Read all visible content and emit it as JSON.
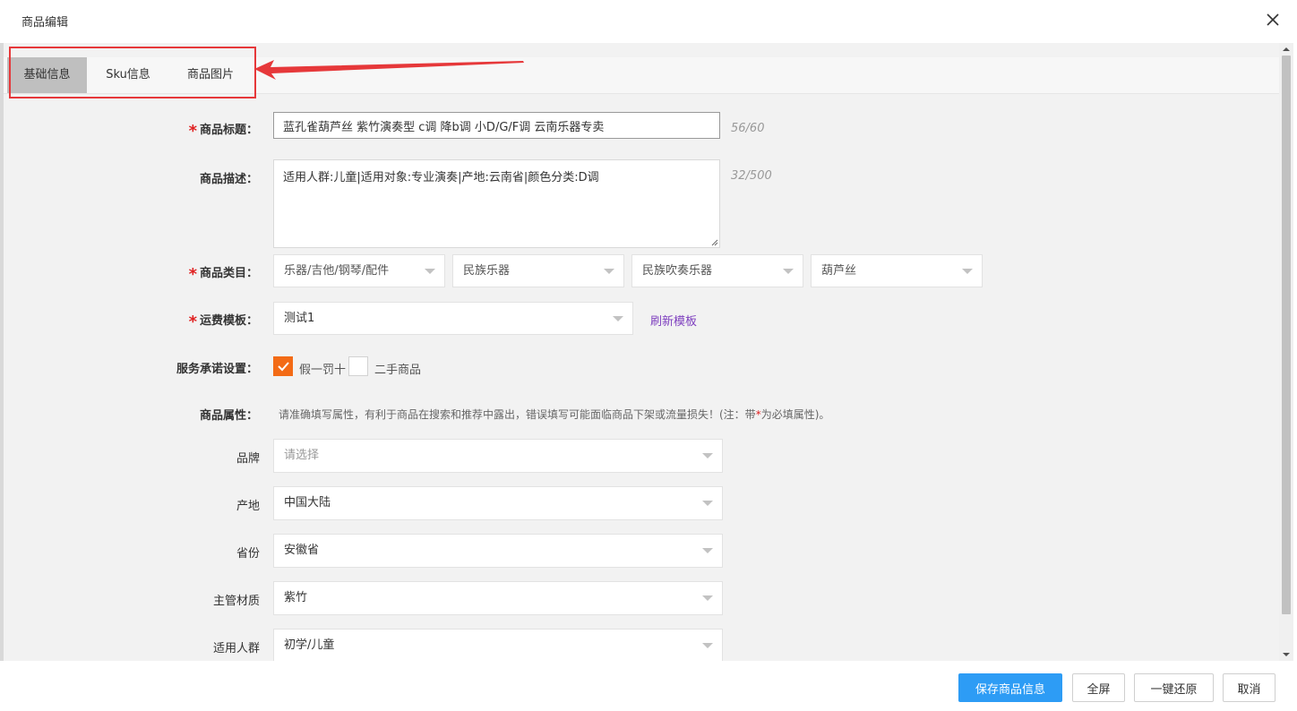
{
  "dialog": {
    "title": "商品编辑"
  },
  "tabs": [
    {
      "label": "基础信息",
      "active": true
    },
    {
      "label": "Sku信息",
      "active": false
    },
    {
      "label": "商品图片",
      "active": false
    }
  ],
  "form": {
    "title": {
      "label": "商品标题：",
      "value": "蓝孔雀葫芦丝 紫竹演奏型 c调 降b调 小D/G/F调 云南乐器专卖",
      "counter": "56/60"
    },
    "description": {
      "label": "商品描述：",
      "value": "适用人群:儿童|适用对象:专业演奏|产地:云南省|颜色分类:D调",
      "counter": "32/500"
    },
    "category": {
      "label": "商品类目：",
      "levels": [
        "乐器/吉他/钢琴/配件",
        "民族乐器",
        "民族吹奏乐器",
        "葫芦丝"
      ]
    },
    "shipping": {
      "label": "运费模板：",
      "value": "测试1",
      "refresh_link": "刷新模板"
    },
    "service": {
      "label": "服务承诺设置：",
      "options": [
        {
          "label": "假一罚十",
          "checked": true
        },
        {
          "label": "二手商品",
          "checked": false
        }
      ]
    },
    "attributes": {
      "label": "商品属性：",
      "hint_before": "请准确填写属性，有利于商品在搜索和推荐中露出，错误填写可能面临商品下架或流量损失！(注：带",
      "hint_star": "*",
      "hint_after": "为必填属性)。",
      "items": [
        {
          "name": "品牌",
          "value": "请选择",
          "placeholder": true
        },
        {
          "name": "产地",
          "value": "中国大陆",
          "placeholder": false
        },
        {
          "name": "省份",
          "value": "安徽省",
          "placeholder": false
        },
        {
          "name": "主管材质",
          "value": "紫竹",
          "placeholder": false
        },
        {
          "name": "适用人群",
          "value": "初学/儿童",
          "placeholder": false
        }
      ]
    }
  },
  "footer": {
    "save": "保存商品信息",
    "fullscreen": "全屏",
    "restore": "一键还原",
    "cancel": "取消"
  },
  "colors": {
    "accent": "#2d9cf5",
    "checkbox_checked": "#f36b16",
    "annotation_red": "#e6383a",
    "link": "#7e3fbf"
  }
}
